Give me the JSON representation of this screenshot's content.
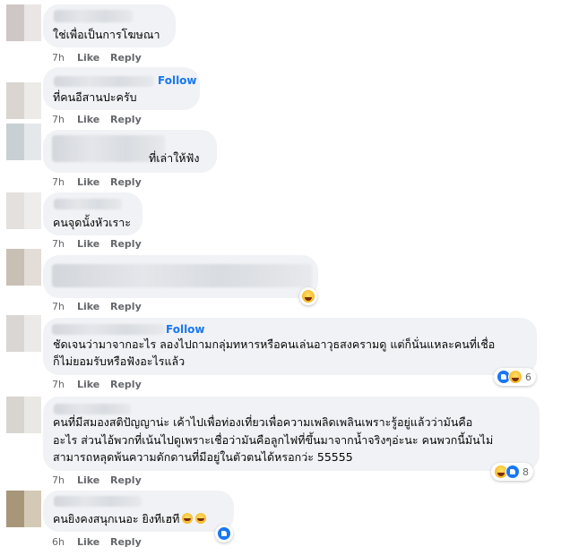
{
  "comments": [
    {
      "text": [
        "ใช่เพื่อเป็นการโฆษณา"
      ],
      "time": "7h",
      "like_label": "Like",
      "reply_label": "Reply"
    },
    {
      "follow": "Follow",
      "text": [
        "ที่คนอีสานปะครับ"
      ],
      "time": "7h",
      "like_label": "Like",
      "reply_label": "Reply"
    },
    {
      "text": [
        "ที่เล่าให้ฟัง"
      ],
      "time": "7h",
      "like_label": "Like",
      "reply_label": "Reply"
    },
    {
      "text": [
        "คนจุดนั้งหัวเราะ"
      ],
      "time": "7h",
      "like_label": "Like",
      "reply_label": "Reply"
    },
    {
      "text": [],
      "time": "7h",
      "like_label": "Like",
      "reply_label": "Reply",
      "reaction": "haha-icon"
    },
    {
      "follow": "Follow",
      "text": [
        "ชัดเจนว่ามาจากอะไร ลองไปถามกลุ่มทหารหรือคนเล่นอาวุธสงครามดู แต่ก็นั่นแหละคนที่เชื่อ",
        "ก็ไม่ยอมรับหรือฟังอะไรแล้ว"
      ],
      "time": "7h",
      "like_label": "Like",
      "reply_label": "Reply",
      "reaction_count": "6"
    },
    {
      "text": [
        "คนที่มีสมองสติปัญญาน่ะ เค้าไปเพื่อท่องเที่ยวเพื่อความเพลิดเพลินเพราะรู้อยู่แล้วว่ามันคือ",
        "อะไร ส่วนไอ้พวกที่เน้นไปดูเพราะเชื่อว่ามันคือลูกไฟที่ขึ้นมาจากน้ำจริงๆอ่ะนะ คนพวกนี้มันไม่",
        "สามารถหลุดพ้นความดักดานที่มีอยู่ในตัวตนได้หรอกว่ะ 55555"
      ],
      "time": "7h",
      "like_label": "Like",
      "reply_label": "Reply",
      "reaction_count": "8"
    },
    {
      "text": [
        "คนยิงคงสนุกเนอะ ยิงทีเฮที"
      ],
      "time": "6h",
      "like_label": "Like",
      "reply_label": "Reply",
      "reaction": "like-icon"
    }
  ],
  "colors": {
    "bubble": "#f0f2f5",
    "follow": "#1877f2",
    "meta": "#65676b",
    "text": "#050505"
  }
}
